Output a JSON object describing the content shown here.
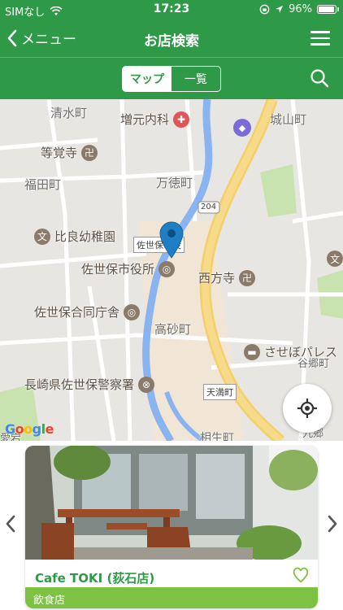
{
  "status_bar": {
    "carrier": "SIMなし",
    "time": "17:23",
    "battery": "96%"
  },
  "nav": {
    "back_label": "メニュー",
    "title": "お店検索"
  },
  "toolbar": {
    "tab_map": "マップ",
    "tab_list": "一覧",
    "active_tab": "マップ"
  },
  "map": {
    "labels": {
      "shimizu": "清水町",
      "zoen": "増元内科",
      "joyama": "城山町",
      "tokyoji": "等覚寺",
      "fukuda": "福田町",
      "mantoku": "万徳町",
      "route": "204",
      "hira": "比良幼稚園",
      "sasebo_st": "佐世保市役",
      "city_hall": "佐世保市役所",
      "saiho": "西方寺",
      "godo": "佐世保合同庁舎",
      "takasago": "高砂町",
      "saseboparesu": "させぼパレス",
      "police": "長崎県佐世保警察署",
      "tenman": "天満町",
      "kugo": "九郷",
      "aioi": "相生町",
      "kago": "谷郷町",
      "atago": "愛宕"
    },
    "google": "Google"
  },
  "card": {
    "title": "Cafe TOKI (荻石店)",
    "category": "飲食店"
  },
  "colors": {
    "brand_green": "#2e9a47",
    "category_green": "#7dc242"
  }
}
